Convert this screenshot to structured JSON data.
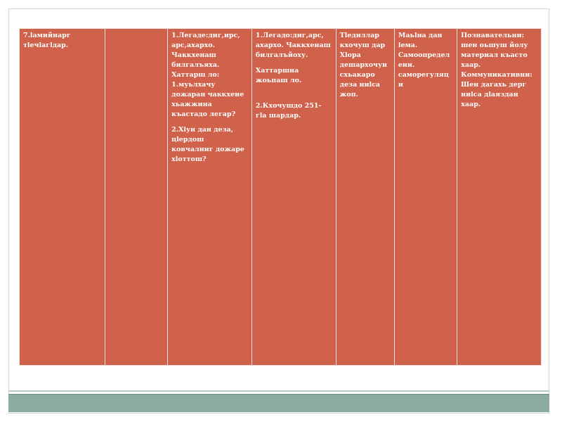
{
  "table": {
    "row": {
      "col1": "7.lамийнарг тlечlагlдар.",
      "col2": "",
      "col3": {
        "p1": "1.Легаде:диг,ирс, арс,ахархо. Чаккхенаш билгалъяха. Хаттарш ло: 1.муьлхачу дожаран чаккхене хьажжина къастадо легар?",
        "p2": "2.Хlун дан деза, цlердош ковчалниг дожаре хlоттош?"
      },
      "col4": {
        "p1": "1.Легадо:диг,арс, ахархо. Чаккхенаш билгалъйоху.",
        "p2": "Хаттаршна жоьпаш ло.",
        "p3": "2.Кхочушдо 251-гlа шардар."
      },
      "col5": "Тlедиллар кхочуш дар Хlора дешархочун схьакаро деза ниlса жоп.",
      "col6": "Маьlна дан lема. Самоопределени. саморегуляци",
      "col7": "Познавательни: шен оьшуш йолу материал къасто хаар. Коммуникативни: Шен дагахь дерг ниlса дlаяздан хаар."
    }
  }
}
